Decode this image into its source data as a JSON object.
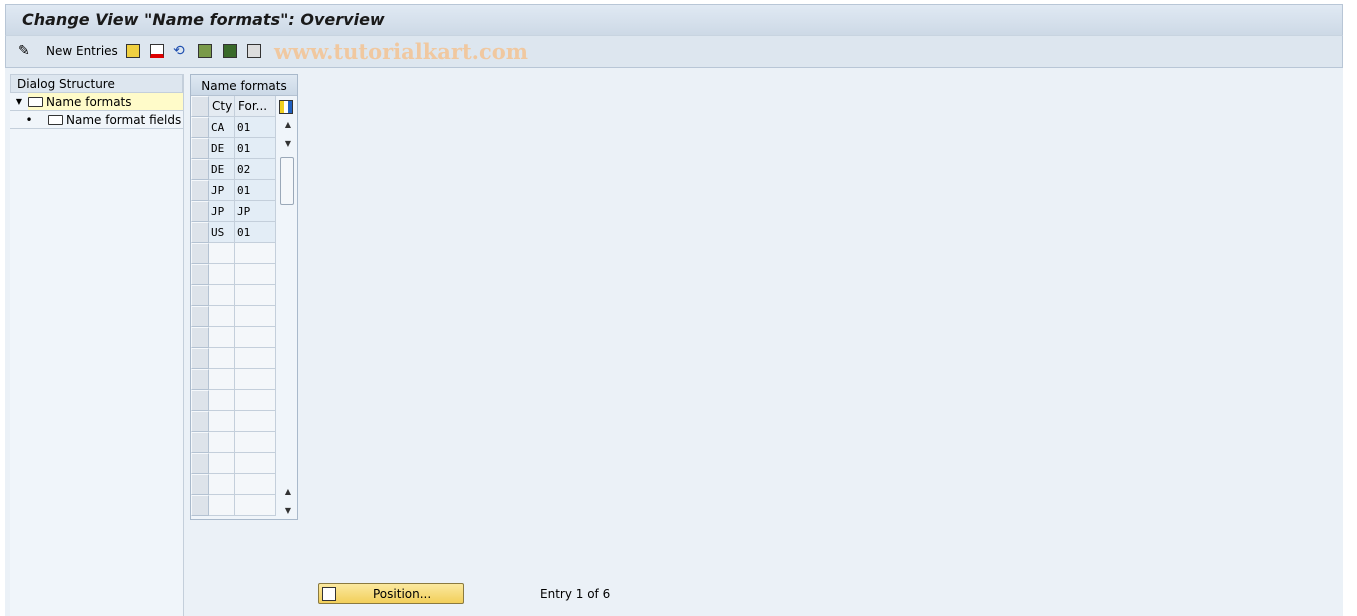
{
  "title": "Change View \"Name formats\": Overview",
  "toolbar": {
    "new_entries": "New Entries",
    "watermark": "www.tutorialkart.com",
    "icons": [
      "edit-toggle-icon",
      "copy-icon",
      "delete-icon",
      "undo-icon",
      "select-all-icon",
      "select-block-icon",
      "deselect-all-icon"
    ]
  },
  "dialog": {
    "header": "Dialog Structure",
    "nodes": [
      {
        "label": "Name formats",
        "selected": true
      },
      {
        "label": "Name format fields"
      }
    ]
  },
  "table": {
    "caption": "Name formats",
    "columns": [
      "Cty",
      "For..."
    ],
    "rows": [
      [
        "CA",
        "01"
      ],
      [
        "DE",
        "01"
      ],
      [
        "DE",
        "02"
      ],
      [
        "JP",
        "01"
      ],
      [
        "JP",
        "JP"
      ],
      [
        "US",
        "01"
      ]
    ],
    "visible_rows": 19
  },
  "footer": {
    "position": "Position...",
    "entry": "Entry 1 of 6"
  },
  "colors": {
    "selected_node": "#fffbc9",
    "button": "#f2cf5a"
  }
}
